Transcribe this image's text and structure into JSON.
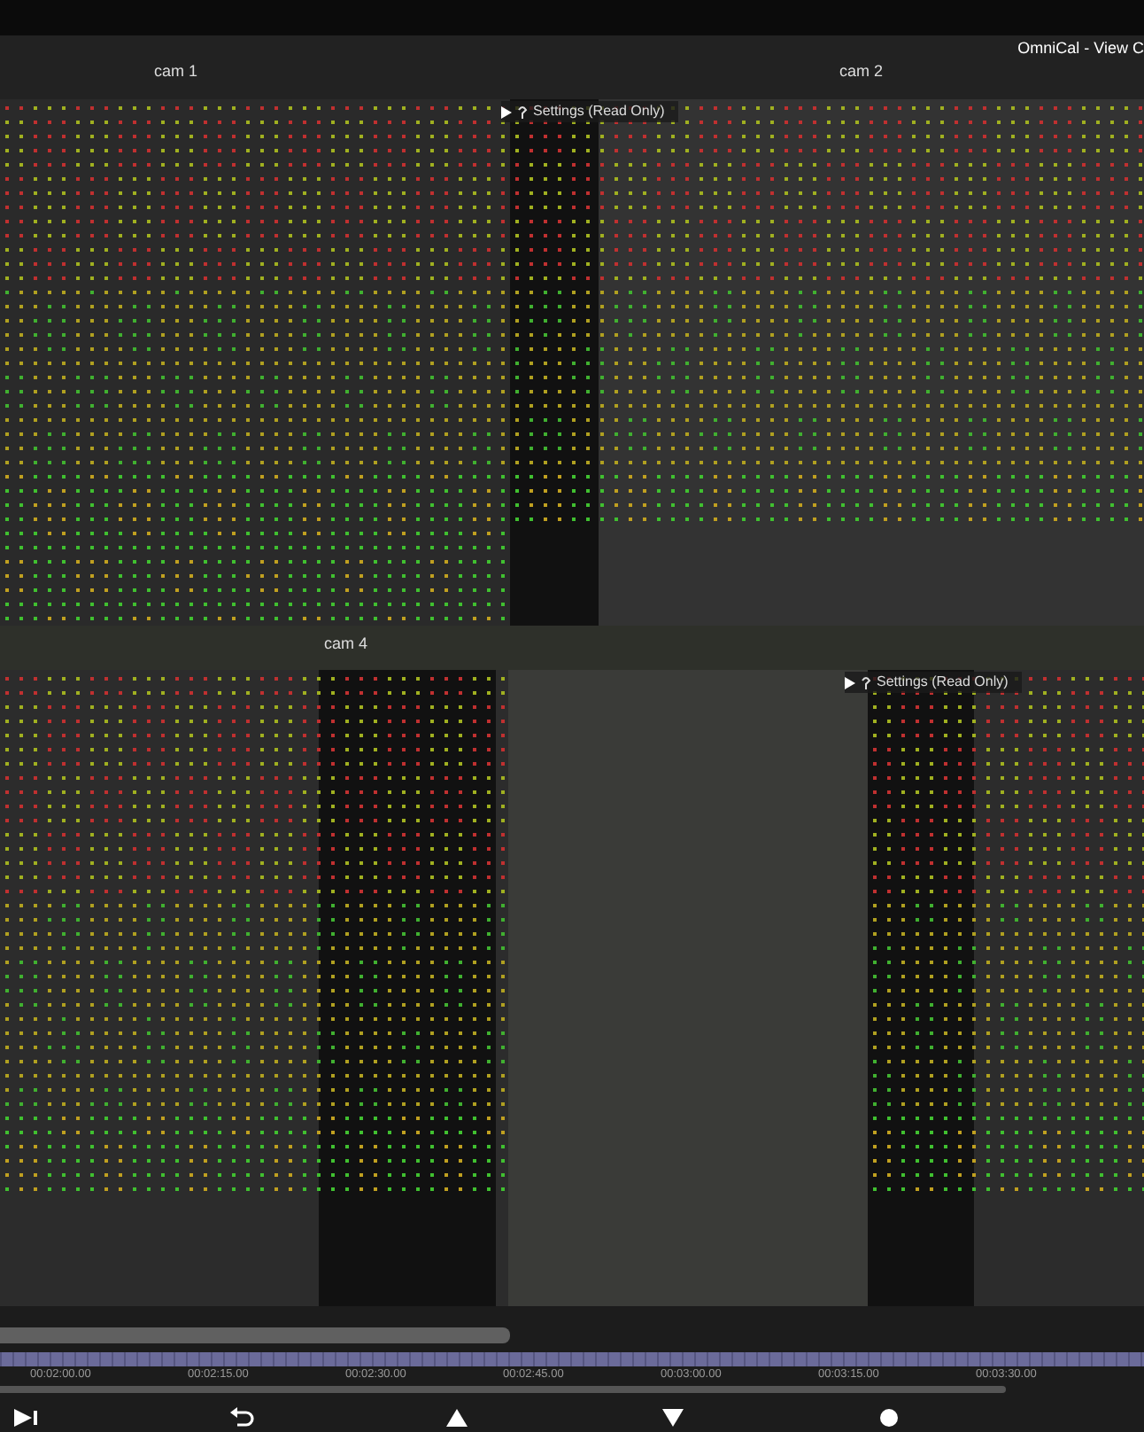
{
  "window": {
    "title": "OmniCal - View C"
  },
  "top_views": [
    {
      "label": "cam 1"
    },
    {
      "label": "cam 2"
    }
  ],
  "middle_label": "cam 4",
  "settings_overlays": [
    {
      "label": "Settings (Read Only)"
    },
    {
      "label": "Settings (Read Only)"
    }
  ],
  "timeline": {
    "labels": [
      "00:02:00.00",
      "00:02:15.00",
      "00:02:30.00",
      "00:02:45.00",
      "00:03:00.00",
      "00:03:15.00",
      "00:03:30.00"
    ]
  },
  "controls": [
    {
      "kind": "step-end"
    },
    {
      "kind": "undo"
    },
    {
      "kind": "up"
    },
    {
      "kind": "down"
    },
    {
      "kind": "record"
    }
  ]
}
